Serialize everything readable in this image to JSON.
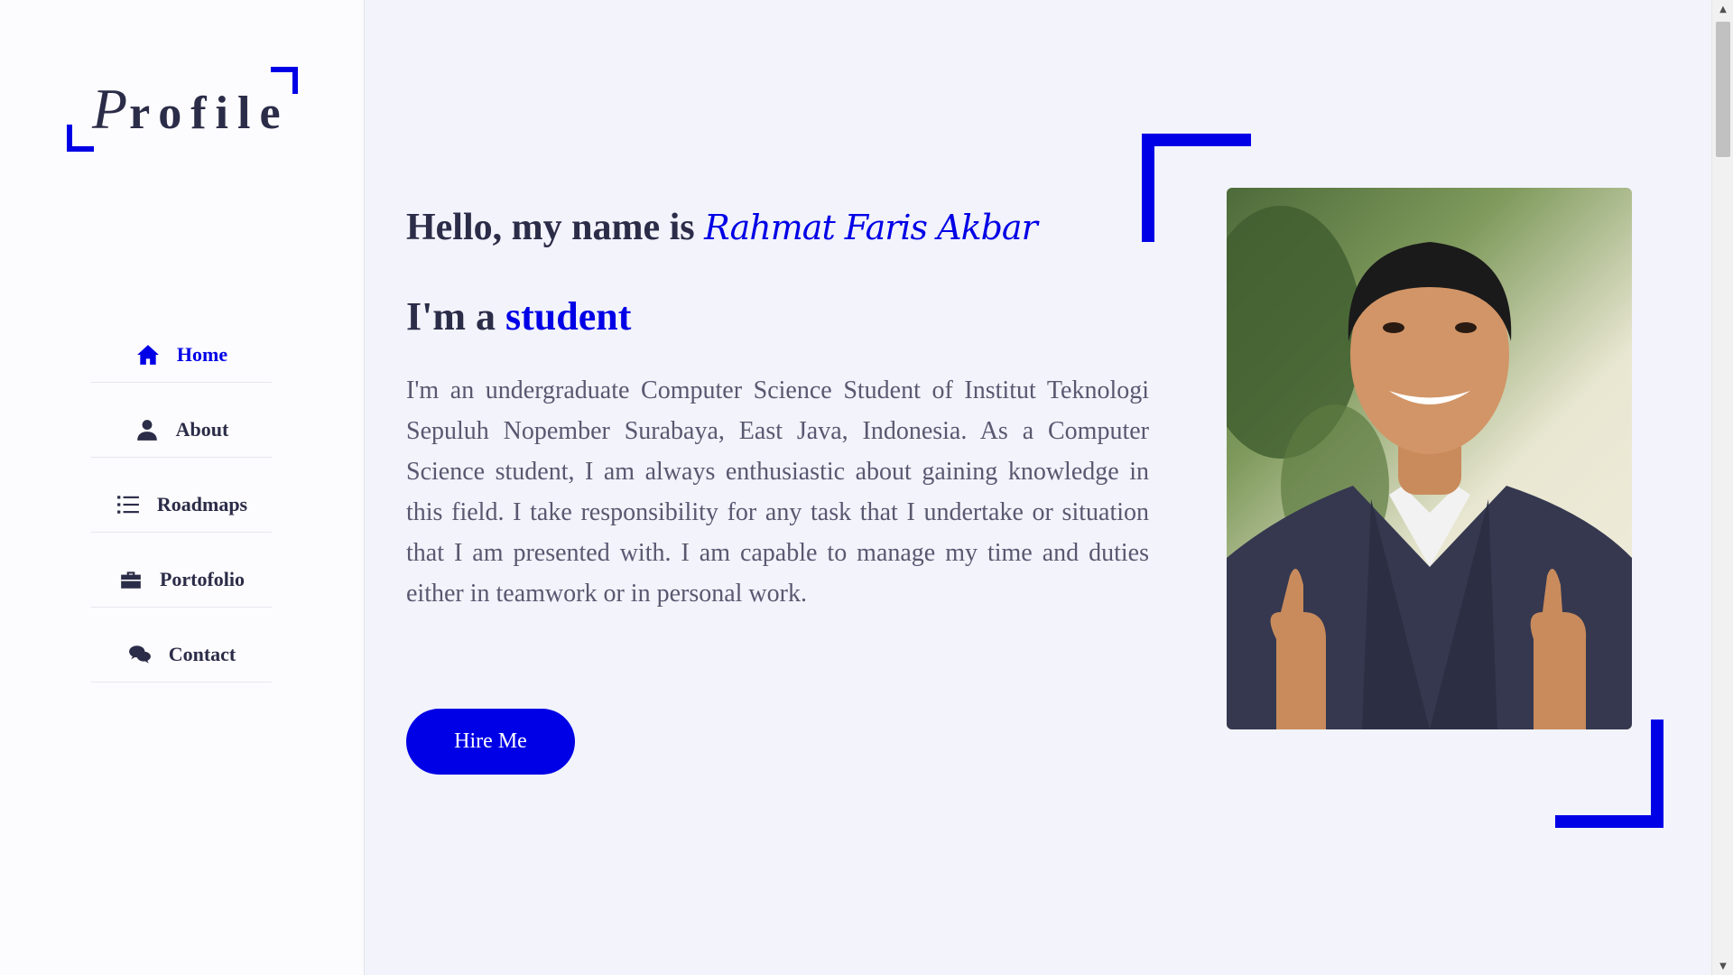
{
  "logo": {
    "initial": "P",
    "rest": "rofile"
  },
  "nav": {
    "items": [
      {
        "label": "Home",
        "icon": "home-icon"
      },
      {
        "label": "About",
        "icon": "user-icon"
      },
      {
        "label": "Roadmaps",
        "icon": "list-icon"
      },
      {
        "label": "Portofolio",
        "icon": "briefcase-icon"
      },
      {
        "label": "Contact",
        "icon": "comments-icon"
      }
    ],
    "active": "Home"
  },
  "hero": {
    "greeting_prefix": "Hello, my name is ",
    "name": "Rahmat Faris Akbar",
    "role_prefix": "I'm a ",
    "role": "student",
    "bio": "I'm an undergraduate Computer Science Student of Institut Teknologi Sepuluh Nopember Surabaya, East Java, Indonesia. As a Computer Science student, I am always enthusiastic about gaining knowledge in this field. I take responsibility for any task that I undertake or situation that I am presented with. I am capable to manage my time and duties either in teamwork or in personal work.",
    "cta_label": "Hire Me"
  },
  "colors": {
    "accent": "#0000e6",
    "text": "#2b2c48",
    "muted": "#585870",
    "background": "#f2f3fb",
    "sidebar": "#fcfbfd"
  }
}
